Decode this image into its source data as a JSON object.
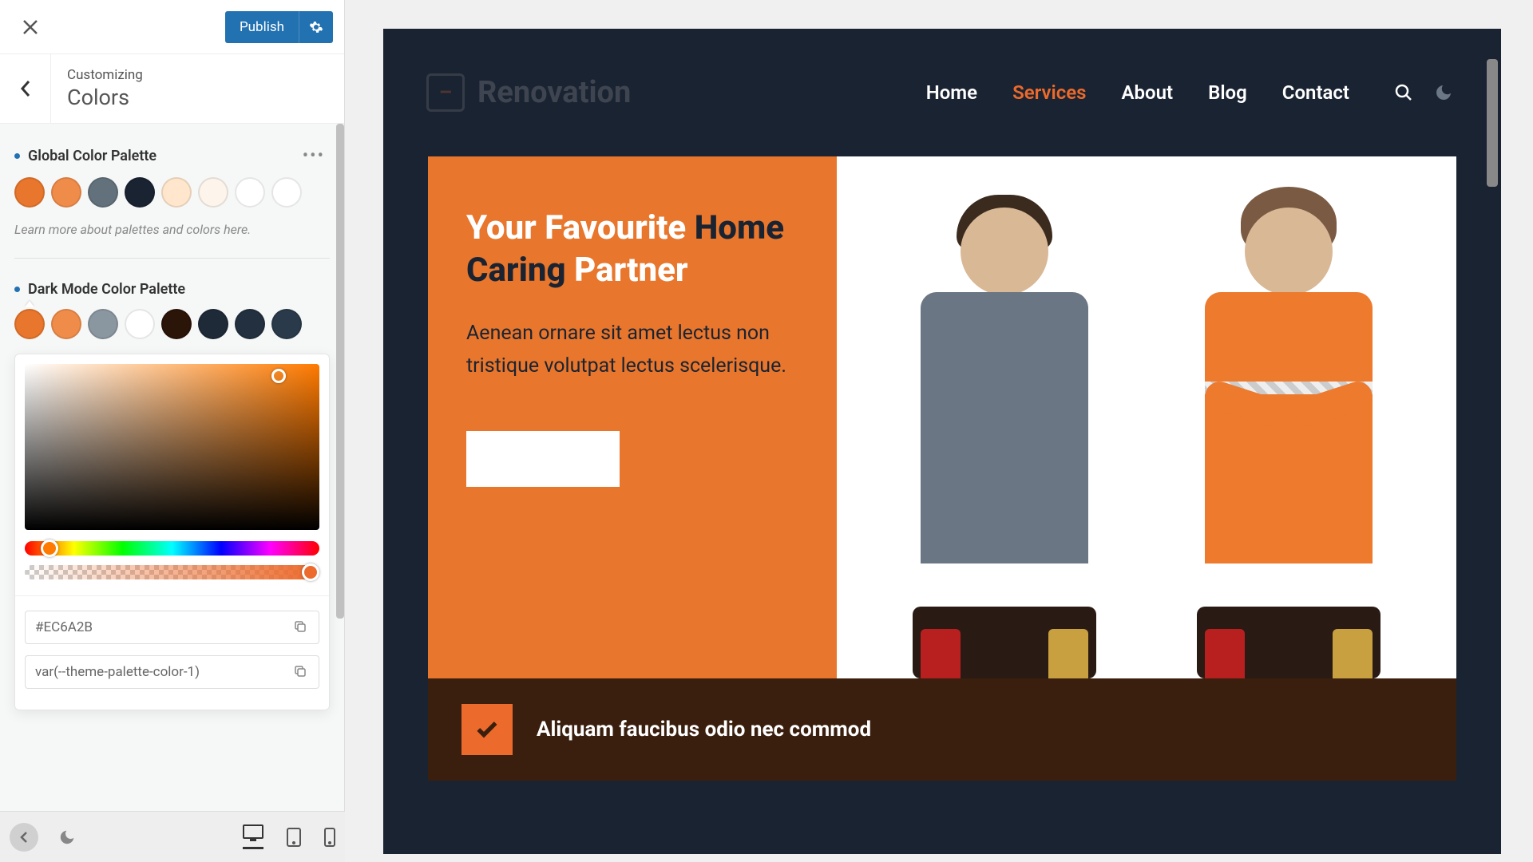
{
  "header": {
    "publish_label": "Publish",
    "crumb": "Customizing",
    "section_title": "Colors"
  },
  "palettes": {
    "global": {
      "label": "Global Color Palette",
      "swatches": [
        "#e8762c",
        "#f08c4a",
        "#62717b",
        "#1a2332",
        "#ffe6cc",
        "#fdf5ec",
        "#ffffff",
        "#ffffff"
      ],
      "learn_more": "Learn more about palettes and colors here."
    },
    "dark": {
      "label": "Dark Mode Color Palette",
      "swatches": [
        "#e8762c",
        "#f08c4a",
        "#8a96a0",
        "#ffffff",
        "#2b1408",
        "#1e2a38",
        "#22303f",
        "#2a3a4a"
      ]
    }
  },
  "picker": {
    "hex_value": "#EC6A2B",
    "var_value": "var(--theme-palette-color-1)"
  },
  "site": {
    "brand": "Renovation",
    "nav": {
      "home": "Home",
      "services": "Services",
      "about": "About",
      "blog": "Blog",
      "contact": "Contact"
    },
    "hero": {
      "title_parts": {
        "p1": "Your Favourite ",
        "p2": "Home Caring ",
        "p3": "Partner"
      },
      "subtitle": "Aenean ornare sit amet lectus non tristique volutpat lectus scelerisque.",
      "cta": ""
    },
    "banner": "Aliquam faucibus odio nec commod"
  }
}
